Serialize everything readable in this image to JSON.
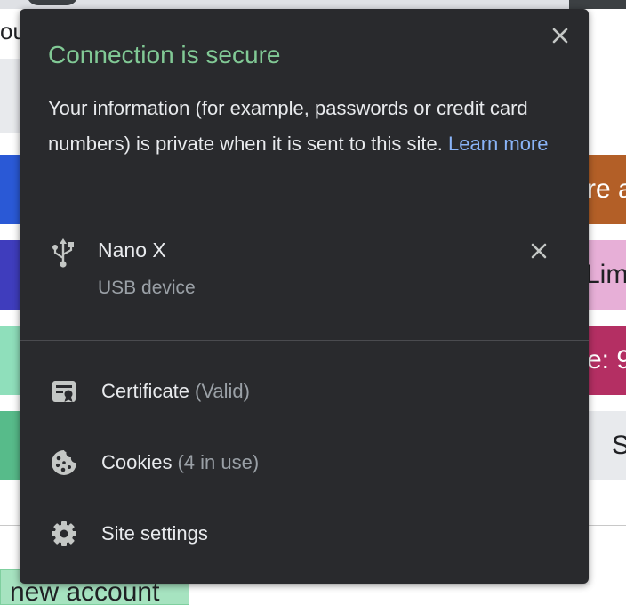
{
  "background": {
    "fragments": {
      "top_left": "ou",
      "right_1": "re a",
      "right_2": "Lim",
      "right_3": "e: 9",
      "right_4": "S",
      "bottom_button": "new account"
    },
    "colors": {
      "blue": "#2a59d6",
      "indigo": "#3f3dbd",
      "mint": "#8fdfbb",
      "green": "#57bb8a",
      "orange": "#b35f27",
      "pink": "#e7afd7",
      "raspberry": "#b42f63",
      "gray": "#e8eaed"
    }
  },
  "popup": {
    "close_icon": "close-icon",
    "title": "Connection is secure",
    "description": "Your information (for example, passwords or credit card numbers) is private when it is sent to this site.",
    "learn_more": "Learn more",
    "device": {
      "icon": "usb-icon",
      "name": "Nano X",
      "type": "USB device",
      "remove_icon": "close-icon"
    },
    "menu": [
      {
        "icon": "certificate-icon",
        "label": "Certificate",
        "sub": "(Valid)"
      },
      {
        "icon": "cookie-icon",
        "label": "Cookies",
        "sub": "(4 in use)"
      },
      {
        "icon": "gear-icon",
        "label": "Site settings",
        "sub": ""
      }
    ],
    "colors": {
      "background": "#292a2d",
      "title": "#81c995",
      "text": "#e8eaed",
      "secondary_text": "#9aa0a6",
      "link": "#8ab4f8",
      "icon": "#c4c7c5"
    }
  }
}
